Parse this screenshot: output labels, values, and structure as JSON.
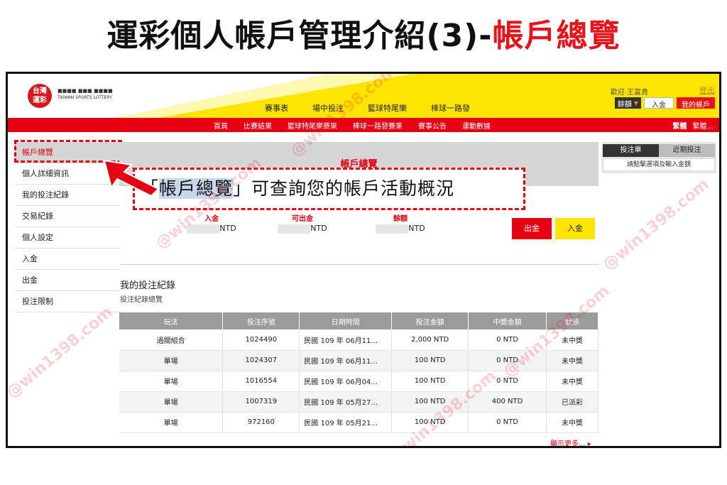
{
  "headline": {
    "black": "運彩個人帳戶管理介紹(3)-",
    "red": "帳戶總覽"
  },
  "logo": {
    "circle_text": "台灣\n運彩",
    "line1": "■■■■ ■■■ ■■■■",
    "line2": "TAIWAN SPORTS LOTTERY"
  },
  "header": {
    "top_nav": [
      "賽事表",
      "場中投注",
      "籃球特尾樂",
      "棒球一路發"
    ],
    "welcome": "歡迎 王富貴",
    "logout": "登出",
    "balance_select": "餘額",
    "deposit_button": "入金",
    "my_account_button": "我的帳戶"
  },
  "red_nav": {
    "items": [
      "首頁",
      "比賽結果",
      "籃球特尾樂賽果",
      "棒球一路發賽果",
      "賽事公告",
      "運動數據"
    ],
    "right_bold": "繁體",
    "right_text": "繁體..."
  },
  "sidebar": {
    "items": [
      "帳戶總覽",
      "個人詳細資訊",
      "我的投注紀錄",
      "交易紀錄",
      "個人設定",
      "入金",
      "出金",
      "投注限制"
    ]
  },
  "main": {
    "title": "帳戶總覽",
    "callout_left": "「",
    "callout_hl": "帳戶總覽",
    "callout_rest": "」可查詢您的帳戶活動概況",
    "summary": {
      "deposit_label": "入金",
      "deposit_unit": "NTD",
      "withdrawable_label": "可出金",
      "withdrawable_unit": "NTD",
      "balance_label": "餘額",
      "balance_unit": "NTD",
      "withdraw_button": "出金",
      "deposit_button": "入金"
    },
    "records_title": "我的投注紀錄",
    "records_sub": "投注紀錄總覽",
    "table": {
      "headers": [
        "玩法",
        "投注序號",
        "日期時間",
        "投注金額",
        "中獎金額",
        "狀態"
      ],
      "rows": [
        [
          "過關組合",
          "1024490",
          "民國 109 年 06月11...",
          "2,000 NTD",
          "0 NTD",
          "未中獎"
        ],
        [
          "單場",
          "1024307",
          "民國 109 年 06月11...",
          "100 NTD",
          "0 NTD",
          "未中獎"
        ],
        [
          "單場",
          "1016554",
          "民國 109 年 06月04...",
          "100 NTD",
          "0 NTD",
          "未中獎"
        ],
        [
          "單場",
          "1007319",
          "民國 109 年 05月27...",
          "100 NTD",
          "400 NTD",
          "已派彩"
        ],
        [
          "單場",
          "972160",
          "民國 109 年 05月21...",
          "100 NTD",
          "0 NTD",
          "未中獎"
        ]
      ]
    },
    "more": "顯示更多..."
  },
  "right_panel": {
    "tab1": "投注單",
    "tab2": "近期投注",
    "hint": "請點擊選項及輸入金額"
  },
  "watermark": "@win1398.com",
  "colors": {
    "brand_red": "#e60012",
    "brand_yellow": "#ffe500"
  }
}
